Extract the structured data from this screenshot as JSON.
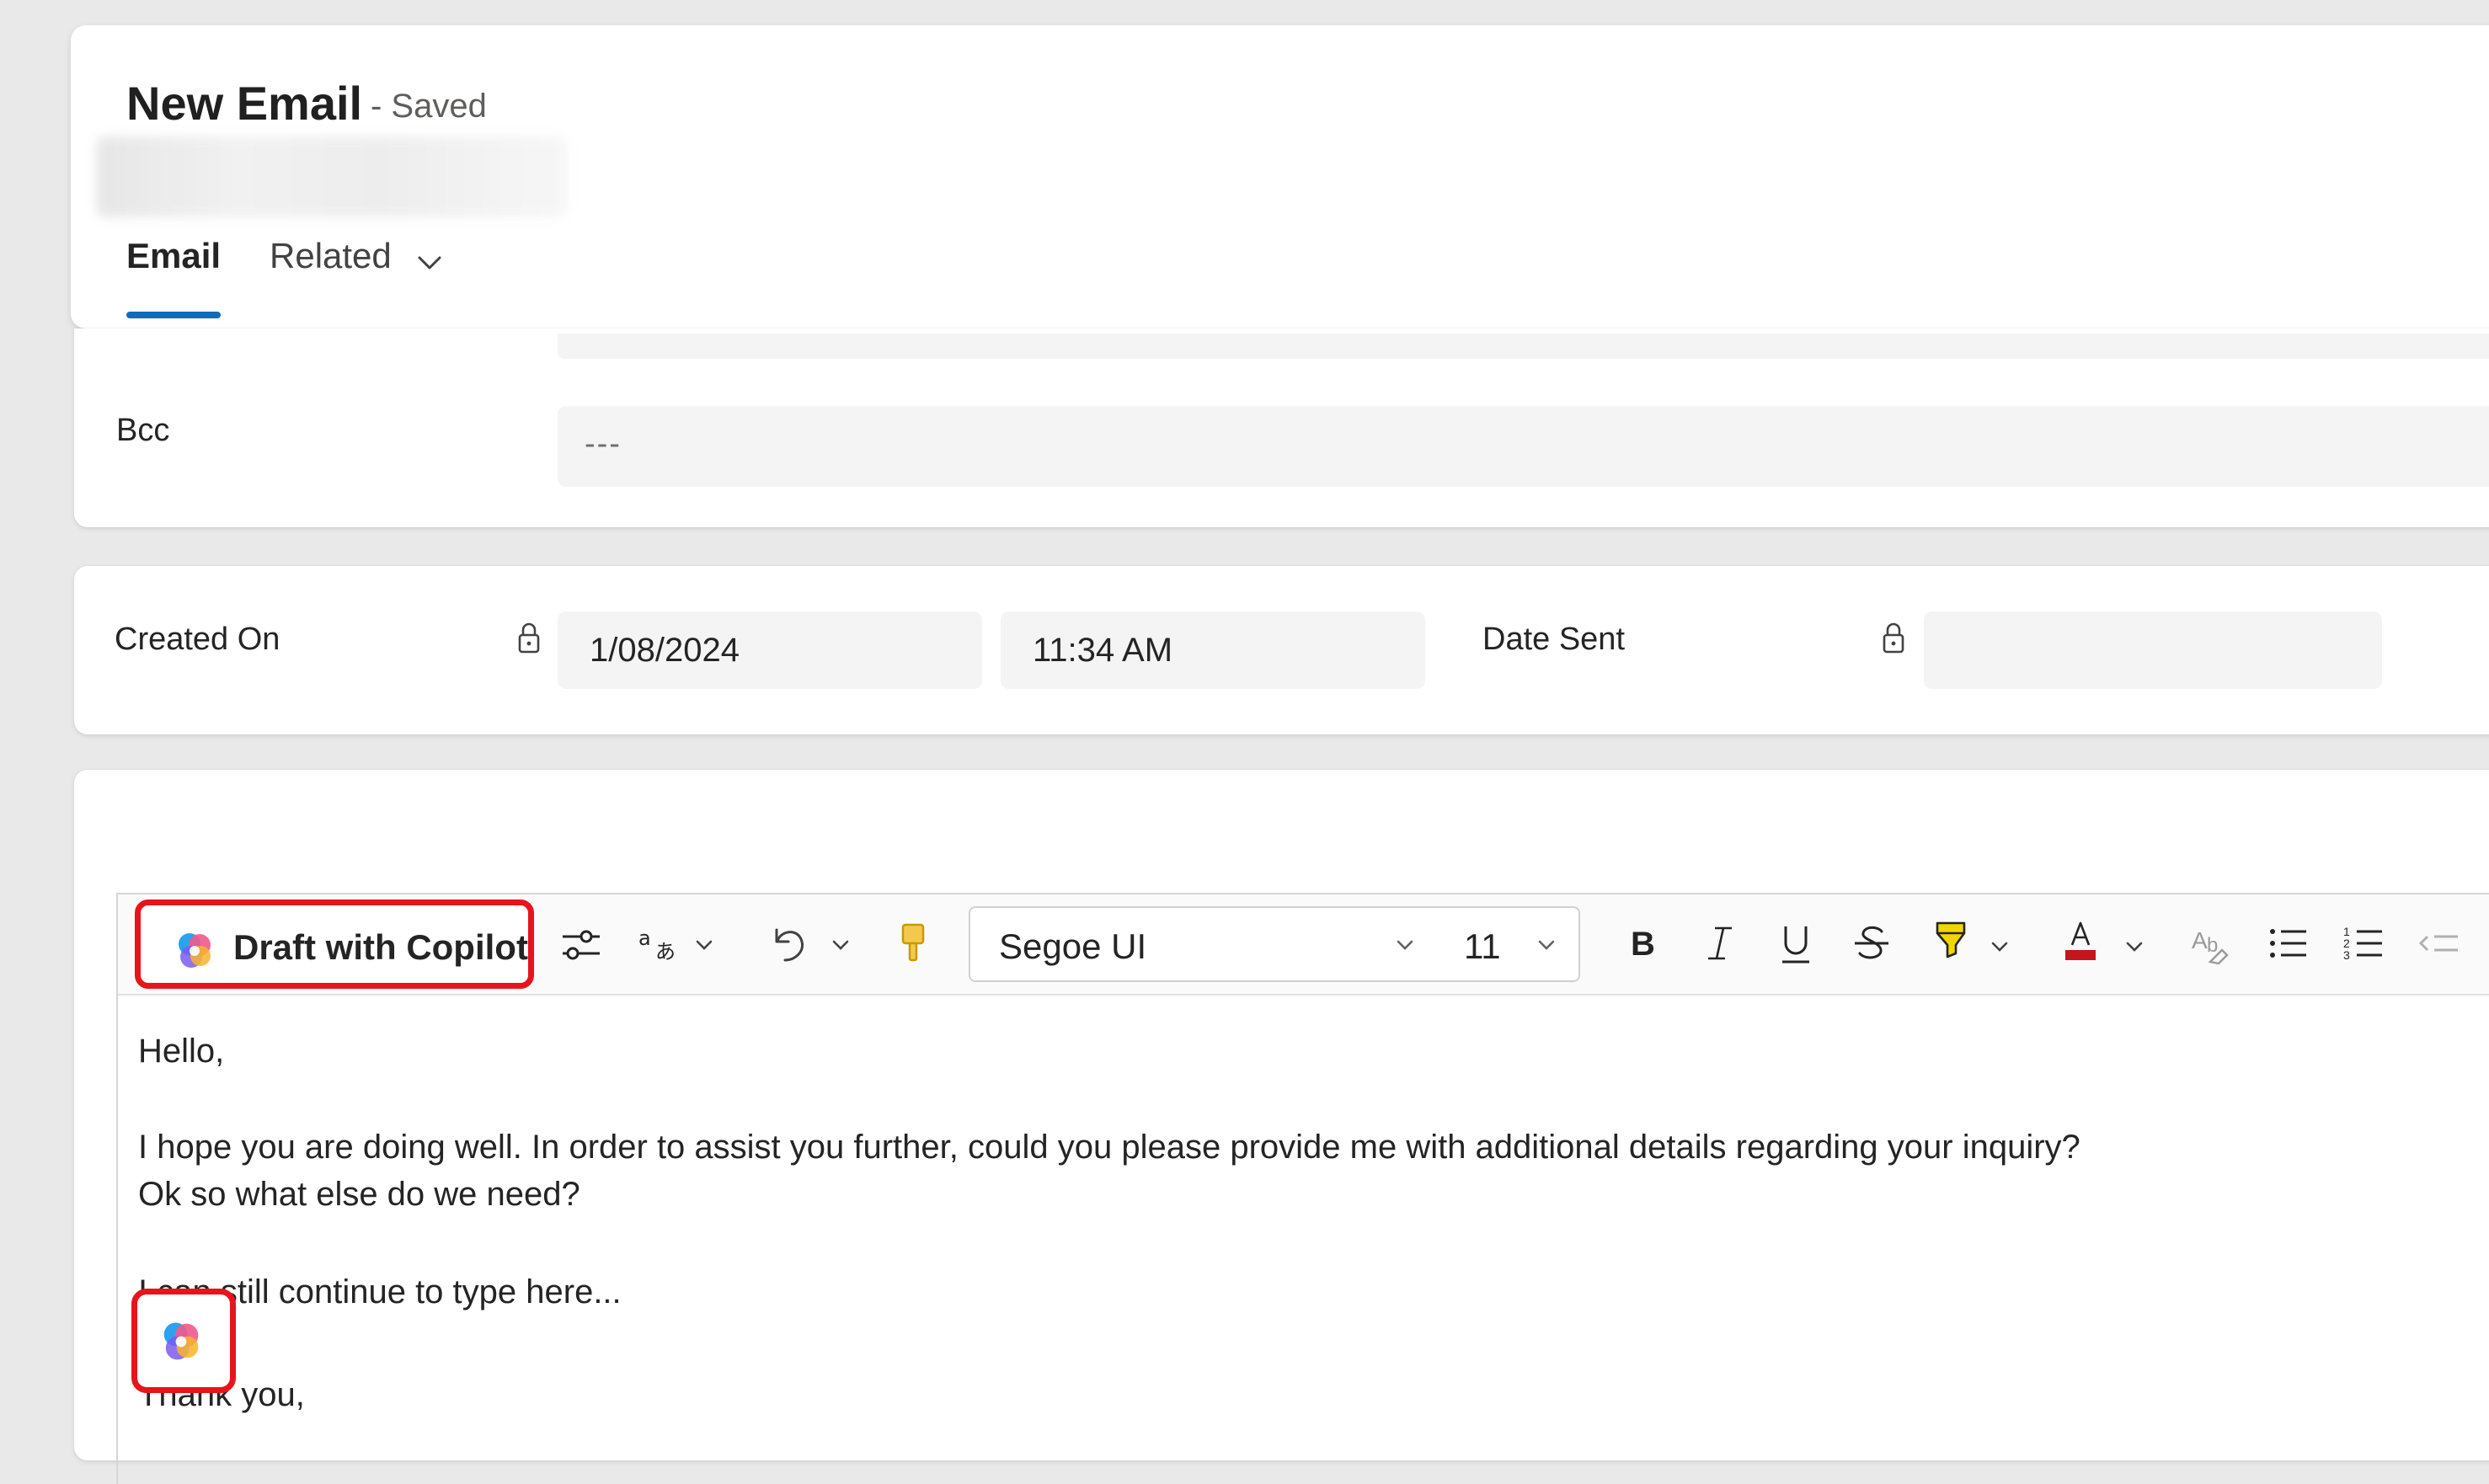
{
  "header": {
    "title": "New Email",
    "status": "- Saved",
    "tabs": [
      {
        "label": "Email",
        "selected": true
      },
      {
        "label": "Related",
        "has_dropdown": true
      }
    ]
  },
  "bcc": {
    "label": "Bcc",
    "value": "---"
  },
  "dates": {
    "created_on_label": "Created On",
    "created_on_date": "1/08/2024",
    "created_on_time": "11:34 AM",
    "date_sent_label": "Date Sent",
    "date_sent_value": ""
  },
  "toolbar": {
    "copilot_label": "Draft with Copilot",
    "font_name": "Segoe UI",
    "font_size": "11",
    "icons": [
      "copilot-icon",
      "adjust-icon",
      "translate-icon",
      "undo-icon",
      "format-painter-icon",
      "bold-icon",
      "italic-icon",
      "underline-icon",
      "strikethrough-icon",
      "highlight-icon",
      "font-color-icon",
      "clear-format-icon",
      "bullet-list-icon",
      "numbered-list-icon",
      "decrease-indent-icon"
    ]
  },
  "body": {
    "lines": [
      "Hello,",
      "I hope you are doing well. In order to assist you further, could you please provide me with additional details regarding your inquiry?",
      "Ok so what else do we need?",
      "I can still continue to type here...",
      "Thank you,"
    ]
  },
  "colors": {
    "accent": "#0f6cbd",
    "highlight_box": "#e8141b",
    "highlighter": "#f2d600",
    "font_color_bar": "#c4151c"
  }
}
